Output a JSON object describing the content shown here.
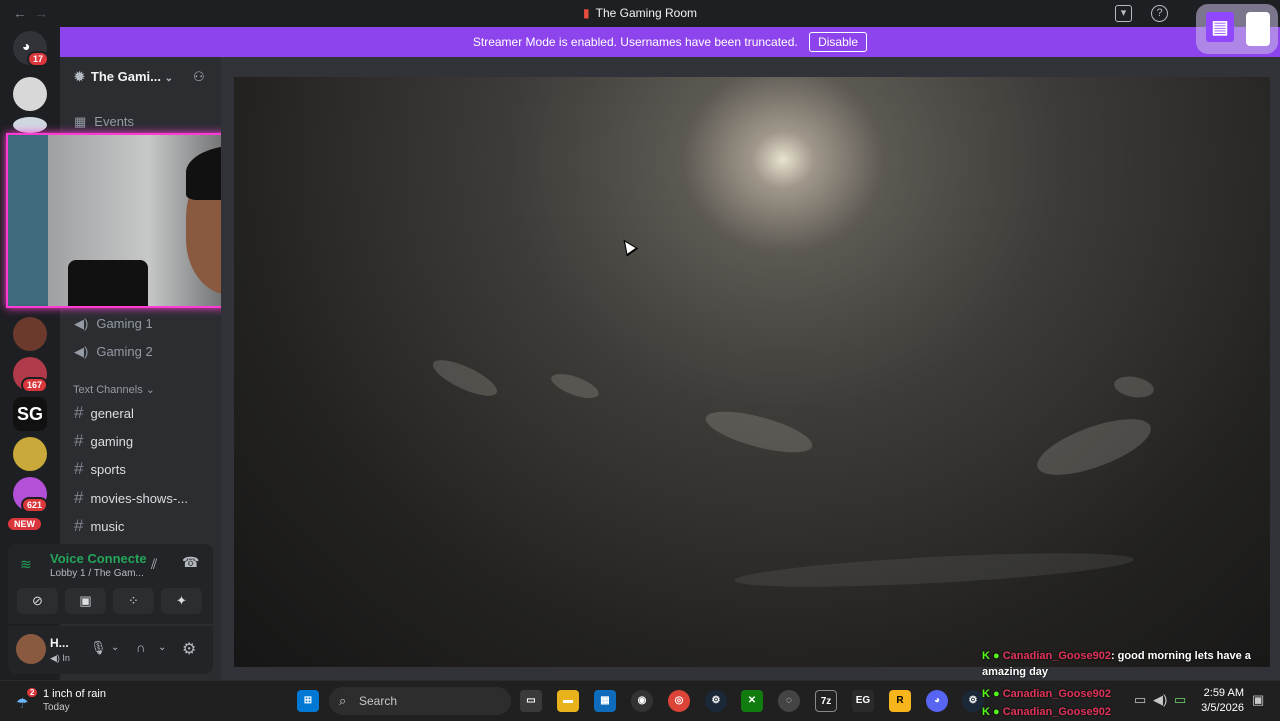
{
  "window": {
    "title": "The Gaming Room"
  },
  "banner": {
    "text": "Streamer Mode is enabled. Usernames have been truncated.",
    "disable_label": "Disable"
  },
  "guilds": {
    "home_badge": "17",
    "badges": [
      "167",
      "621"
    ],
    "new_label": "NEW"
  },
  "sidebar": {
    "server_name": "The Gami...",
    "events_label": "Events",
    "voice_channels": [
      "Gaming 1",
      "Gaming 2"
    ],
    "text_category": "Text Channels",
    "text_channels": [
      "general",
      "gaming",
      "sports",
      "movies-shows-...",
      "music"
    ]
  },
  "voice_panel": {
    "status": "Voice Connecte",
    "location": "Lobby 1 / The Gam..."
  },
  "user_panel": {
    "name": "H...",
    "status": "In"
  },
  "chat_overlay": {
    "messages": [
      {
        "user": "Canadian_Goose902",
        "text": ": good morning lets have a amazing day"
      }
    ],
    "extra_users": [
      "Canadian_Goose902",
      "Canadian_Goose902"
    ]
  },
  "taskbar": {
    "weather_text": "1 inch of rain",
    "weather_sub": "Today",
    "weather_badge": "2",
    "search_placeholder": "Search",
    "time": "2:59 AM",
    "date": "3/5/2026"
  },
  "colors": {
    "banner": "#8e44ec",
    "webcam_border": "#ff3bd4",
    "voice_connected": "#23a55a",
    "chat_name": "#e0345a",
    "badge": "#da373c"
  }
}
